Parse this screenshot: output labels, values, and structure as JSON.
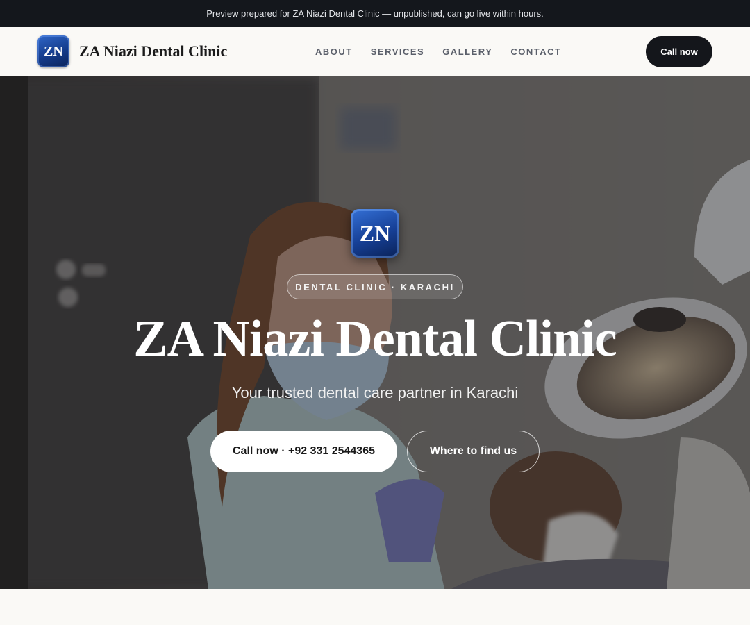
{
  "preview_banner": {
    "text": "Preview prepared for ZA Niazi Dental Clinic — unpublished, can go live within hours."
  },
  "header": {
    "logo_text": "ZN",
    "brand_name": "ZA Niazi Dental Clinic",
    "nav": [
      {
        "label": "ABOUT"
      },
      {
        "label": "SERVICES"
      },
      {
        "label": "GALLERY"
      },
      {
        "label": "CONTACT"
      }
    ],
    "cta_label": "Call now"
  },
  "hero": {
    "logo_text": "ZN",
    "badge": "DENTAL CLINIC · KARACHI",
    "title": "ZA Niazi Dental Clinic",
    "subtitle": "Your trusted dental care partner in Karachi",
    "primary_button": "Call now · +92 331 2544365",
    "secondary_button": "Where to find us",
    "background_image": "dentist-with-patient-photo"
  },
  "colors": {
    "preview_bar_bg": "#14171c",
    "header_bg": "#faf9f6",
    "cta_bg": "#14161b",
    "logo_blue": "#163f95",
    "nav_text": "#5a5f6a"
  }
}
